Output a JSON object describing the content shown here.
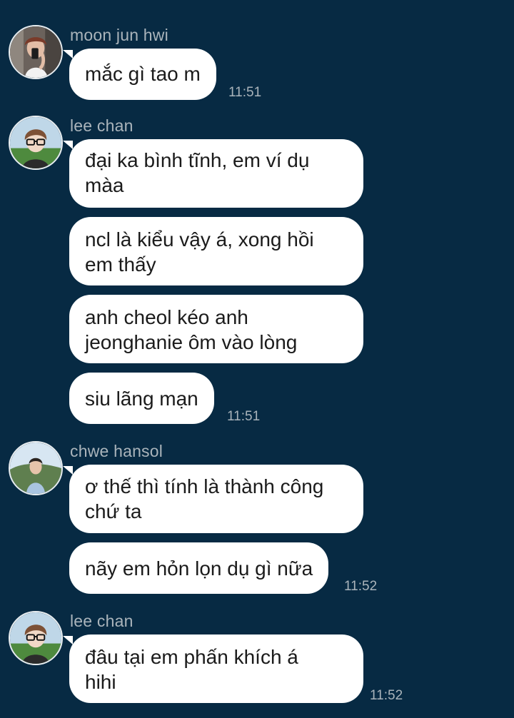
{
  "groups": [
    {
      "sender": "moon jun hwi",
      "avatar": "avatar-moon-jun-hwi",
      "messages": [
        {
          "lines": [
            "mắc gì tao m"
          ],
          "time": "11:51"
        }
      ]
    },
    {
      "sender": "lee chan",
      "avatar": "avatar-lee-chan",
      "messages": [
        {
          "lines": [
            "đại ka bình tĩnh, em ví dụ",
            "màa"
          ],
          "time": ""
        },
        {
          "lines": [
            "ncl là kiểu vậy á, xong hồi",
            "em thấy"
          ],
          "time": ""
        },
        {
          "lines": [
            "anh cheol kéo anh",
            "jeonghanie ôm vào lòng"
          ],
          "time": ""
        },
        {
          "lines": [
            "siu lãng mạn"
          ],
          "time": "11:51"
        }
      ]
    },
    {
      "sender": "chwe hansol",
      "avatar": "avatar-chwe-hansol",
      "messages": [
        {
          "lines": [
            "ơ thế thì tính là thành công",
            "chứ ta"
          ],
          "time": ""
        },
        {
          "lines": [
            "nãy em hỏn lọn dụ gì nữa"
          ],
          "time": "11:52"
        }
      ]
    },
    {
      "sender": "lee chan",
      "avatar": "avatar-lee-chan",
      "messages": [
        {
          "lines": [
            "đâu tại em phấn khích á",
            "hihi"
          ],
          "time": "11:52"
        }
      ]
    }
  ]
}
